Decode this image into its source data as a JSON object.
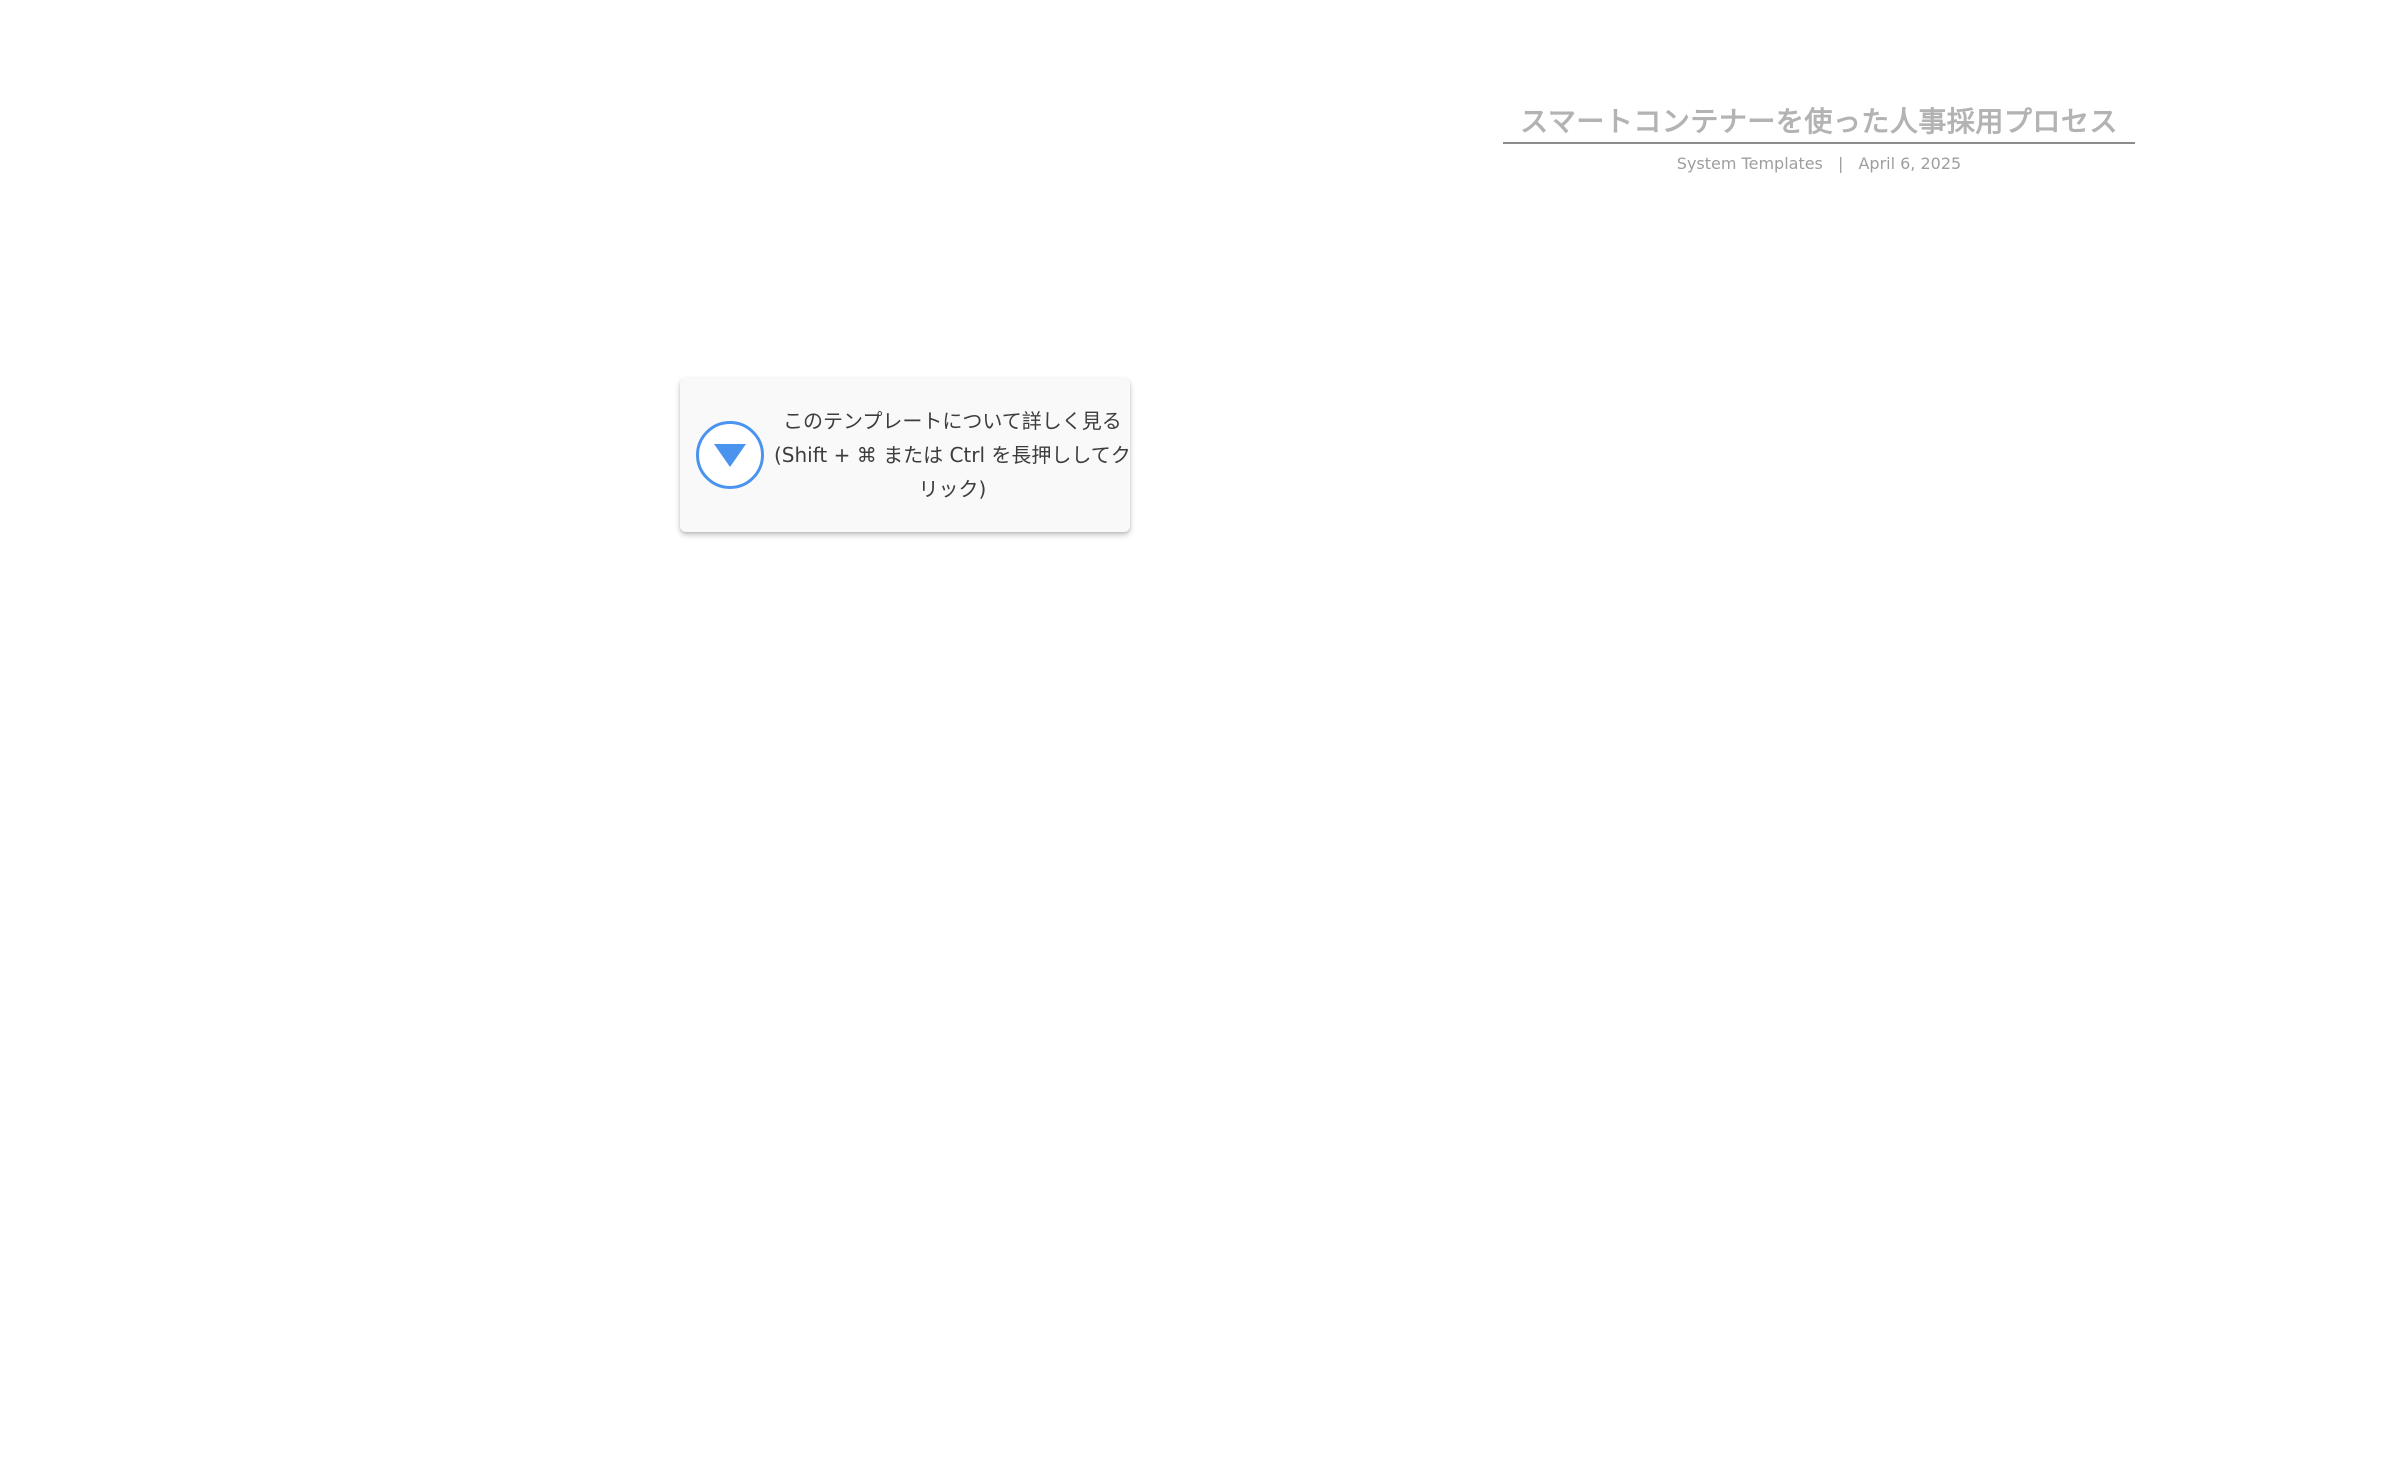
{
  "document": {
    "title": "スマートコンテナーを使った人事採用プロセス",
    "author": "System Templates",
    "separator": "|",
    "date": "April 6, 2025"
  },
  "info_card": {
    "icon": "play-triangle-icon",
    "line1": "このテンプレートについて詳しく見る",
    "line2": "(Shift + ⌘ または Ctrl を長押ししてク",
    "line3": "リック)",
    "accent_color": "#4a94f0"
  }
}
